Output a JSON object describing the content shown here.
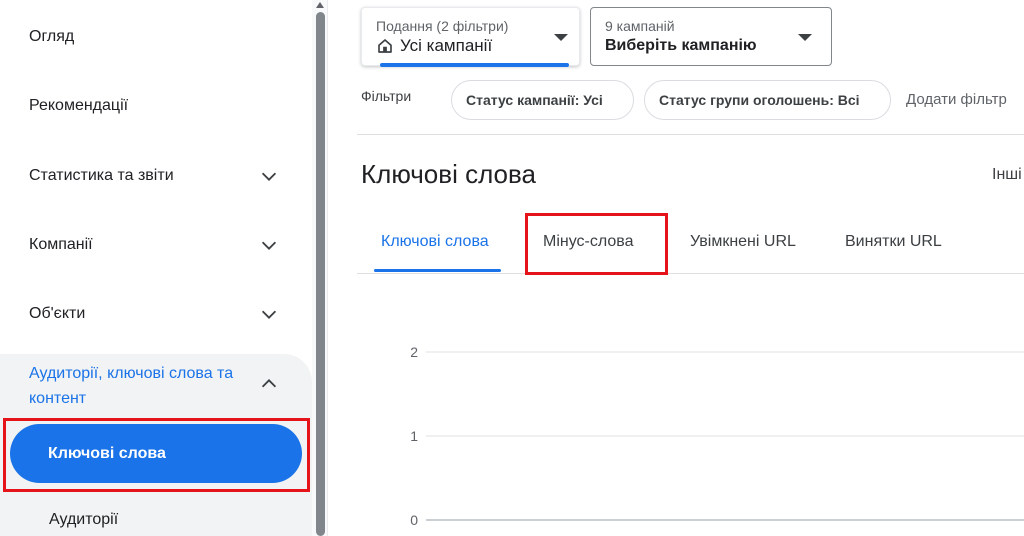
{
  "sidebar": {
    "items": [
      {
        "label": "Огляд",
        "expandable": false
      },
      {
        "label": "Рекомендації",
        "expandable": false
      },
      {
        "label": "Статистика та звіти",
        "expandable": true
      },
      {
        "label": "Компанії",
        "expandable": true
      },
      {
        "label": "Об'єкти",
        "expandable": true
      }
    ],
    "audiences_group": {
      "label": "Аудиторії, ключові слова та контент",
      "expanded": true,
      "children": [
        {
          "label": "Ключові слова",
          "active": true
        },
        {
          "label": "Аудиторії",
          "active": false
        }
      ]
    }
  },
  "header": {
    "view_dropdown": {
      "label": "Подання (2 фільтри)",
      "value": "Усі кампанії",
      "icon": "home-icon"
    },
    "campaign_dropdown": {
      "label": "9 кампаній",
      "value": "Виберіть кампанію"
    }
  },
  "filters": {
    "label": "Фільтри",
    "chips": [
      "Статус кампанії: Усі",
      "Статус групи оголошень: Всі"
    ],
    "add_filter": "Додати фільтр"
  },
  "page": {
    "title": "Ключові слова",
    "other_truncated": "Інші"
  },
  "tabs": [
    {
      "label": "Ключові слова",
      "active": true
    },
    {
      "label": "Мінус-слова",
      "active": false,
      "highlighted": true
    },
    {
      "label": "Увімкнені URL",
      "active": false
    },
    {
      "label": "Винятки URL",
      "active": false
    }
  ],
  "chart_data": {
    "type": "line",
    "y_ticks": [
      "2",
      "1",
      "0"
    ],
    "ylim": [
      0,
      2
    ],
    "series": []
  },
  "colors": {
    "accent": "#1a73e8",
    "highlight_box": "#e5141b"
  }
}
